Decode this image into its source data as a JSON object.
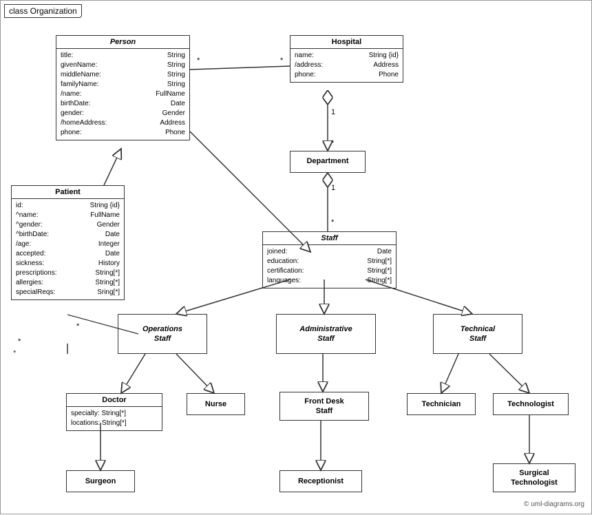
{
  "title": "class Organization",
  "copyright": "© uml-diagrams.org",
  "boxes": {
    "person": {
      "title": "Person",
      "attrs": [
        [
          "title:",
          "String"
        ],
        [
          "givenName:",
          "String"
        ],
        [
          "middleName:",
          "String"
        ],
        [
          "familyName:",
          "String"
        ],
        [
          "/name:",
          "FullName"
        ],
        [
          "birthDate:",
          "Date"
        ],
        [
          "gender:",
          "Gender"
        ],
        [
          "/homeAddress:",
          "Address"
        ],
        [
          "phone:",
          "Phone"
        ]
      ]
    },
    "hospital": {
      "title": "Hospital",
      "attrs": [
        [
          "name:",
          "String {id}"
        ],
        [
          "/address:",
          "Address"
        ],
        [
          "phone:",
          "Phone"
        ]
      ]
    },
    "department": {
      "title": "Department",
      "attrs": []
    },
    "staff": {
      "title": "Staff",
      "attrs": [
        [
          "joined:",
          "Date"
        ],
        [
          "education:",
          "String[*]"
        ],
        [
          "certification:",
          "String[*]"
        ],
        [
          "languages:",
          "String[*]"
        ]
      ]
    },
    "patient": {
      "title": "Patient",
      "attrs": [
        [
          "id:",
          "String {id}"
        ],
        [
          "^name:",
          "FullName"
        ],
        [
          "^gender:",
          "Gender"
        ],
        [
          "^birthDate:",
          "Date"
        ],
        [
          "/age:",
          "Integer"
        ],
        [
          "accepted:",
          "Date"
        ],
        [
          "sickness:",
          "History"
        ],
        [
          "prescriptions:",
          "String[*]"
        ],
        [
          "allergies:",
          "String[*]"
        ],
        [
          "specialReqs:",
          "Sring[*]"
        ]
      ]
    },
    "operations_staff": {
      "title": "Operations\nStaff",
      "italic": true
    },
    "admin_staff": {
      "title": "Administrative\nStaff",
      "italic": true
    },
    "technical_staff": {
      "title": "Technical\nStaff",
      "italic": true
    },
    "doctor": {
      "title": "Doctor",
      "attrs": [
        [
          "specialty: String[*]"
        ],
        [
          "locations: String[*]"
        ]
      ]
    },
    "nurse": {
      "title": "Nurse",
      "attrs": []
    },
    "front_desk": {
      "title": "Front Desk\nStaff",
      "attrs": []
    },
    "technician": {
      "title": "Technician",
      "attrs": []
    },
    "technologist": {
      "title": "Technologist",
      "attrs": []
    },
    "surgeon": {
      "title": "Surgeon",
      "attrs": []
    },
    "receptionist": {
      "title": "Receptionist",
      "attrs": []
    },
    "surgical_tech": {
      "title": "Surgical\nTechnologist",
      "attrs": []
    }
  }
}
